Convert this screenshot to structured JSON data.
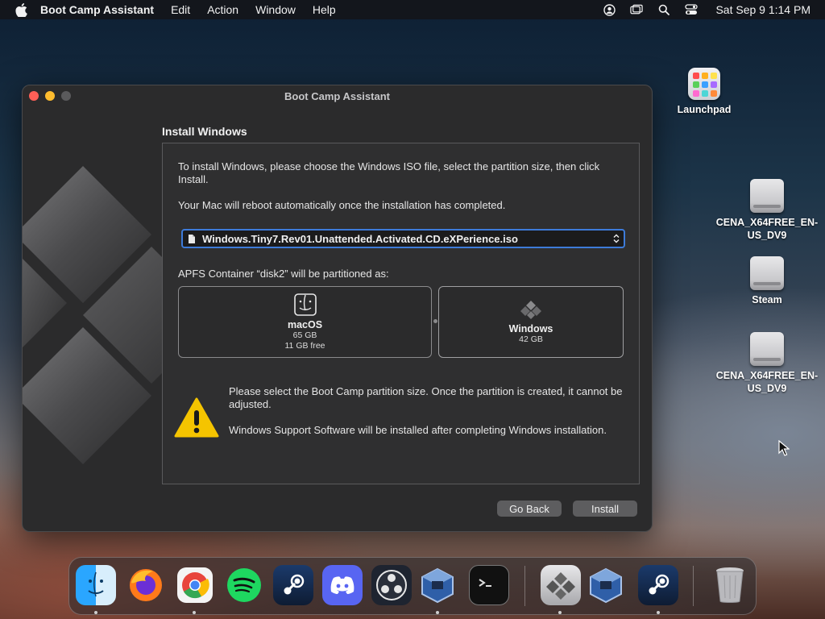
{
  "menubar": {
    "app_name": "Boot Camp Assistant",
    "menus": [
      "Edit",
      "Action",
      "Window",
      "Help"
    ],
    "clock": "Sat Sep 9  1:14 PM"
  },
  "desktop": {
    "icons": [
      {
        "label": "Launchpad"
      },
      {
        "label": "CENA_X64FREE_EN-US_DV9"
      },
      {
        "label": "Steam"
      },
      {
        "label": "CENA_X64FREE_EN-US_DV9"
      }
    ]
  },
  "window": {
    "title": "Boot Camp Assistant",
    "section_heading": "Install Windows",
    "intro": "To install Windows, please choose the Windows ISO file, select the partition size, then click Install.",
    "reboot_note": "Your Mac will reboot automatically once the installation has completed.",
    "iso_file": "Windows.Tiny7.Rev01.Unattended.Activated.CD.eXPerience.iso",
    "partition_heading": "APFS Container “disk2” will be partitioned as:",
    "partitions": {
      "macos": {
        "name": "macOS",
        "size": "65 GB",
        "free": "11 GB free"
      },
      "windows": {
        "name": "Windows",
        "size": "42 GB"
      }
    },
    "warning_1": "Please select the Boot Camp partition size. Once the partition is created, it cannot be adjusted.",
    "warning_2": "Windows Support Software will be installed after completing Windows installation.",
    "buttons": {
      "back": "Go Back",
      "install": "Install"
    }
  },
  "dock": {
    "apps": [
      "finder-icon",
      "firefox-icon",
      "chrome-icon",
      "spotify-icon",
      "steam-icon",
      "discord-icon",
      "obs-icon",
      "virtualbox-icon",
      "terminal-icon",
      "boot-camp-assistant-icon",
      "virtualbox-icon",
      "steam-icon",
      "trash-icon"
    ]
  },
  "colors": {
    "accent": "#3d7bd9",
    "warning": "#f5c400"
  }
}
